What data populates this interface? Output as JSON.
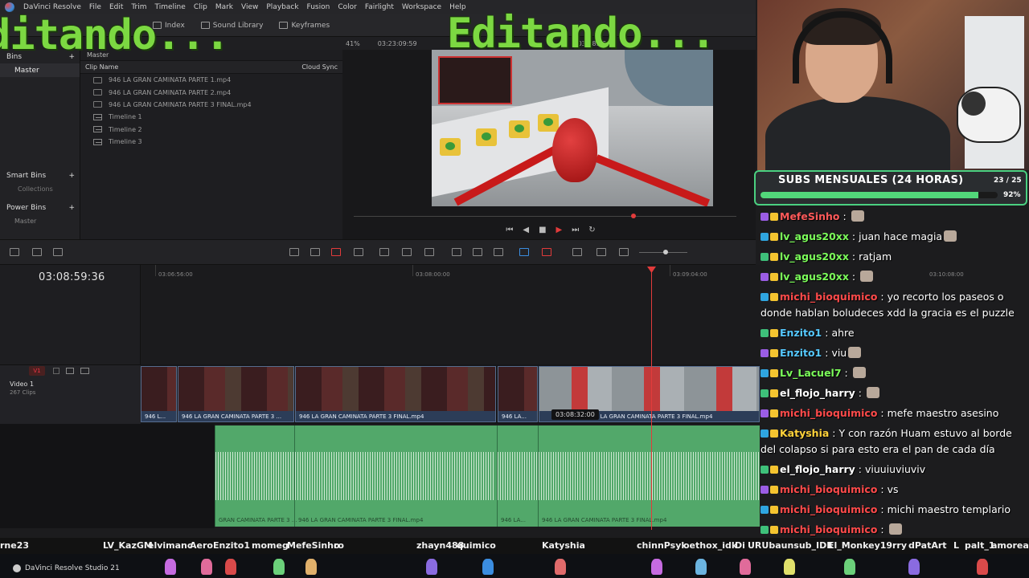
{
  "menu": {
    "items": [
      "DaVinci Resolve",
      "File",
      "Edit",
      "Trim",
      "Timeline",
      "Clip",
      "Mark",
      "View",
      "Playback",
      "Fusion",
      "Color",
      "Fairlight",
      "Workspace",
      "Help"
    ]
  },
  "toolbar": {
    "index": "Index",
    "sound_library": "Sound Library",
    "keyframes": "Keyframes",
    "zoom": "41%",
    "timecode_viewer": "03:23:09:59",
    "timecode_viewer_right": "03:08:59:36"
  },
  "bins": {
    "bins_label": "Bins",
    "master": "Master",
    "smart_bins": "Smart Bins",
    "collections": "Collections",
    "power_bins": "Power Bins",
    "power_master": "Master"
  },
  "media_pool": {
    "path": "Master",
    "col_name": "Clip Name",
    "col_sync": "Cloud Sync",
    "clips": [
      {
        "name": "946 LA GRAN CAMINATA PARTE 1.mp4",
        "type": "clip"
      },
      {
        "name": "946 LA GRAN CAMINATA PARTE 2.mp4",
        "type": "clip"
      },
      {
        "name": "946 LA GRAN CAMINATA PARTE 3 FINAL.mp4",
        "type": "clip"
      },
      {
        "name": "Timeline 1",
        "type": "timeline"
      },
      {
        "name": "Timeline 2",
        "type": "timeline"
      },
      {
        "name": "Timeline 3",
        "type": "timeline"
      }
    ]
  },
  "timeline": {
    "timecode": "03:08:59:36",
    "ruler": [
      "03:06:56:00",
      "03:08:00:00",
      "03:09:04:00",
      "03:10:08:00"
    ],
    "track_badge": "V1",
    "track_name": "Video 1",
    "clip_count": "267 Clips",
    "hover_timecode": "03:08:32:00",
    "video_clips": [
      {
        "label": "946 L..."
      },
      {
        "label": "946 LA GRAN CAMINATA PARTE 3 ..."
      },
      {
        "label": "946 LA GRAN CAMINATA PARTE 3 FINAL.mp4"
      },
      {
        "label": "946 LA..."
      },
      {
        "label": "946 LA GRAN CAMINATA PARTE 3 FINAL.mp4"
      }
    ],
    "audio_clips": [
      {
        "label": "GRAN CAMINATA PARTE 3 ..."
      },
      {
        "label": "946 LA GRAN CAMINATA PARTE 3 FINAL.mp4"
      },
      {
        "label": "946 LA..."
      },
      {
        "label": "946 LA GRAN CAMINATA PARTE 3 FINAL.mp4"
      }
    ]
  },
  "overlay": {
    "left_text": "ditando...",
    "center_text": "Editando..."
  },
  "subs": {
    "title": "SUBS MENSUALES (24 HORAS)",
    "count": "23 / 25",
    "percent": "92%",
    "fill": 0.92
  },
  "chat": [
    {
      "user": "MefeSinho",
      "text": "",
      "color": "#ff5a5a",
      "emote": true
    },
    {
      "user": "lv_agus20xx",
      "text": "juan hace magia",
      "color": "#7cff5a",
      "emote": true
    },
    {
      "user": "lv_agus20xx",
      "text": "ratjam",
      "color": "#7cff5a",
      "emote": false
    },
    {
      "user": "lv_agus20xx",
      "text": "",
      "color": "#7cff5a",
      "emote": true
    },
    {
      "user": "michi_bioquimico",
      "text": "yo recorto los paseos o donde hablan boludeces xdd la gracia es el puzzle",
      "color": "#ff4a4a",
      "emote": false
    },
    {
      "user": "Enzito1",
      "text": "ahre",
      "color": "#55c8ff",
      "emote": false
    },
    {
      "user": "Enzito1",
      "text": "viu",
      "color": "#55c8ff",
      "emote": true
    },
    {
      "user": "Lv_Lacuel7",
      "text": "",
      "color": "#7cff5a",
      "emote": true
    },
    {
      "user": "el_flojo_harry",
      "text": "",
      "color": "#ffffff",
      "emote": true
    },
    {
      "user": "michi_bioquimico",
      "text": "mefe maestro asesino",
      "color": "#ff4a4a",
      "emote": false
    },
    {
      "user": "Katyshia",
      "text": "Y con razón Huam estuvo al borde del colapso si para esto era el pan de cada día",
      "color": "#ffd23a",
      "emote": false
    },
    {
      "user": "el_flojo_harry",
      "text": "viuuiuviuviv",
      "color": "#ffffff",
      "emote": false
    },
    {
      "user": "michi_bioquimico",
      "text": "vs",
      "color": "#ff4a4a",
      "emote": false
    },
    {
      "user": "michi_bioquimico",
      "text": "michi maestro templario",
      "color": "#ff4a4a",
      "emote": false
    },
    {
      "user": "michi_bioquimico",
      "text": "",
      "color": "#ff4a4a",
      "emote": true
    }
  ],
  "ticker": [
    "rne23",
    "LV_KazGM",
    "elvimanc",
    "Aero",
    "Enzito1",
    "momeg",
    "MefeSinho",
    "ro",
    "zhayn488",
    "quimico",
    "Katyshia",
    "chinnPsyk",
    "oethox_idk",
    "Di",
    "URUbaunsub_IDK",
    "El_Monkey19",
    "rry",
    "dPatArt",
    "L",
    "palt_1",
    "amoreal"
  ],
  "taskbar": {
    "app": "DaVinci Resolve Studio 21"
  }
}
